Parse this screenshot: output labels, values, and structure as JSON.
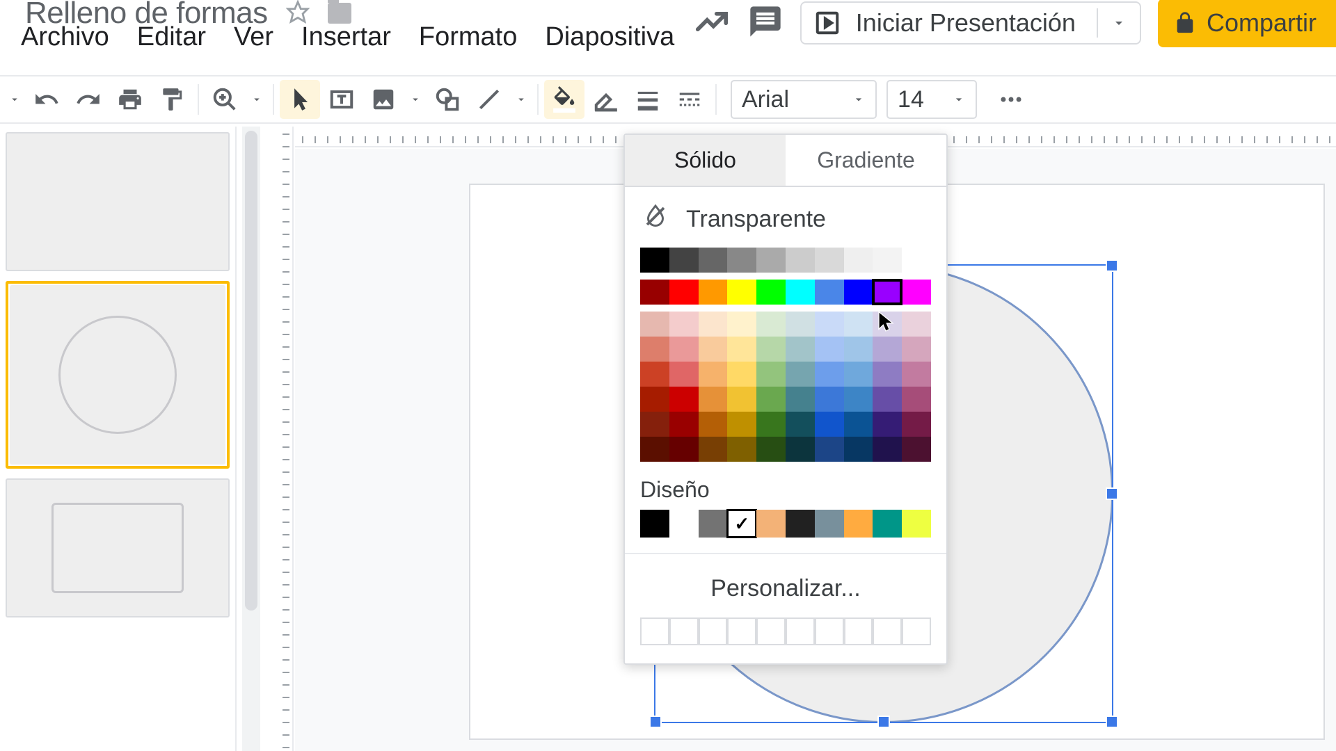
{
  "doc_title": "Relleno de formas",
  "menubar": {
    "items": [
      "Archivo",
      "Editar",
      "Ver",
      "Insertar",
      "Formato",
      "Diapositiva"
    ]
  },
  "present_button": {
    "label": "Iniciar Presentación"
  },
  "share_button": {
    "label": "Compartir"
  },
  "toolbar": {
    "font_name": "Arial",
    "font_size": "14"
  },
  "color_picker": {
    "tabs": {
      "solid": "Sólido",
      "gradient": "Gradiente"
    },
    "active_tab": "solid",
    "transparent_label": "Transparente",
    "theme_section_label": "Diseño",
    "customize_label": "Personalizar...",
    "grays": [
      "#000000",
      "#434343",
      "#666666",
      "#888888",
      "#aaaaaa",
      "#cccccc",
      "#d9d9d9",
      "#efefef",
      "#f3f3f3",
      "#ffffff"
    ],
    "main_row": [
      "#980000",
      "#ff0000",
      "#ff9900",
      "#ffff00",
      "#00ff00",
      "#00ffff",
      "#4a86e8",
      "#0000ff",
      "#9900ff",
      "#ff00ff"
    ],
    "selected_main": "#9900ff",
    "shade_rows": [
      [
        "#e6b8af",
        "#f4cccc",
        "#fce5cd",
        "#fff2cc",
        "#d9ead3",
        "#d0e0e3",
        "#c9daf8",
        "#cfe2f3",
        "#d9d2e9",
        "#ead1dc"
      ],
      [
        "#dd7e6b",
        "#ea9999",
        "#f9cb9c",
        "#ffe599",
        "#b6d7a8",
        "#a2c4c9",
        "#a4c2f4",
        "#9fc5e8",
        "#b4a7d6",
        "#d5a6bd"
      ],
      [
        "#cc4125",
        "#e06666",
        "#f6b26b",
        "#ffd966",
        "#93c47d",
        "#76a5af",
        "#6d9eeb",
        "#6fa8dc",
        "#8e7cc3",
        "#c27ba0"
      ],
      [
        "#a61c00",
        "#cc0000",
        "#e69138",
        "#f1c232",
        "#6aa84f",
        "#45818e",
        "#3c78d8",
        "#3d85c6",
        "#674ea7",
        "#a64d79"
      ],
      [
        "#85200c",
        "#990000",
        "#b45f06",
        "#bf9000",
        "#38761d",
        "#134f5c",
        "#1155cc",
        "#0b5394",
        "#351c75",
        "#741b47"
      ],
      [
        "#5b0f00",
        "#660000",
        "#783f04",
        "#7f6000",
        "#274e13",
        "#0c343d",
        "#1c4587",
        "#073763",
        "#20124d",
        "#4c1130"
      ]
    ],
    "theme_colors": [
      "#000000",
      null,
      "#737373",
      "#ffffff",
      "#f3b277",
      "#212121",
      "#78909c",
      "#ffab40",
      "#009688",
      "#eeff41"
    ],
    "theme_checked_index": 3,
    "custom_slots": 10
  }
}
